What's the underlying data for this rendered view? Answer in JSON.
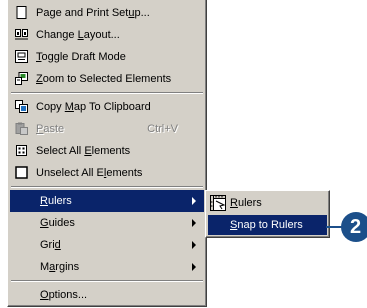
{
  "menu": {
    "items": [
      {
        "label_pre": "Page and Print Set",
        "label_u": "u",
        "label_post": "p...",
        "icon": "page-setup-icon"
      },
      {
        "label_pre": "Change ",
        "label_u": "L",
        "label_post": "ayout...",
        "icon": "change-layout-icon"
      },
      {
        "label_pre": "",
        "label_u": "T",
        "label_post": "oggle Draft Mode",
        "icon": "draft-mode-icon"
      },
      {
        "label_pre": "",
        "label_u": "Z",
        "label_post": "oom to Selected Elements",
        "icon": "zoom-selected-icon"
      },
      {
        "label_pre": "Copy ",
        "label_u": "M",
        "label_post": "ap To Clipboard",
        "icon": "copy-map-icon"
      },
      {
        "label_pre": "",
        "label_u": "P",
        "label_post": "aste",
        "shortcut": "Ctrl+V",
        "icon": "paste-icon"
      },
      {
        "label_pre": "Select All ",
        "label_u": "E",
        "label_post": "lements",
        "icon": "select-all-icon"
      },
      {
        "label_pre": "Unselect All E",
        "label_u": "l",
        "label_post": "ements",
        "icon": "unselect-all-icon"
      },
      {
        "label_pre": "",
        "label_u": "R",
        "label_post": "ulers"
      },
      {
        "label_pre": "",
        "label_u": "G",
        "label_post": "uides"
      },
      {
        "label_pre": "Gri",
        "label_u": "d",
        "label_post": ""
      },
      {
        "label_pre": "M",
        "label_u": "a",
        "label_post": "rgins"
      },
      {
        "label_pre": "",
        "label_u": "O",
        "label_post": "ptions..."
      }
    ]
  },
  "submenu": {
    "items": [
      {
        "label_pre": "",
        "label_u": "R",
        "label_post": "ulers",
        "icon": "rulers-icon"
      },
      {
        "label_pre": "",
        "label_u": "S",
        "label_post": "nap to Rulers"
      }
    ]
  },
  "callout": {
    "number": "2"
  },
  "colors": {
    "menu_bg": "#d4d0c8",
    "highlight": "#0a246a",
    "callout": "#1c4f8a"
  }
}
